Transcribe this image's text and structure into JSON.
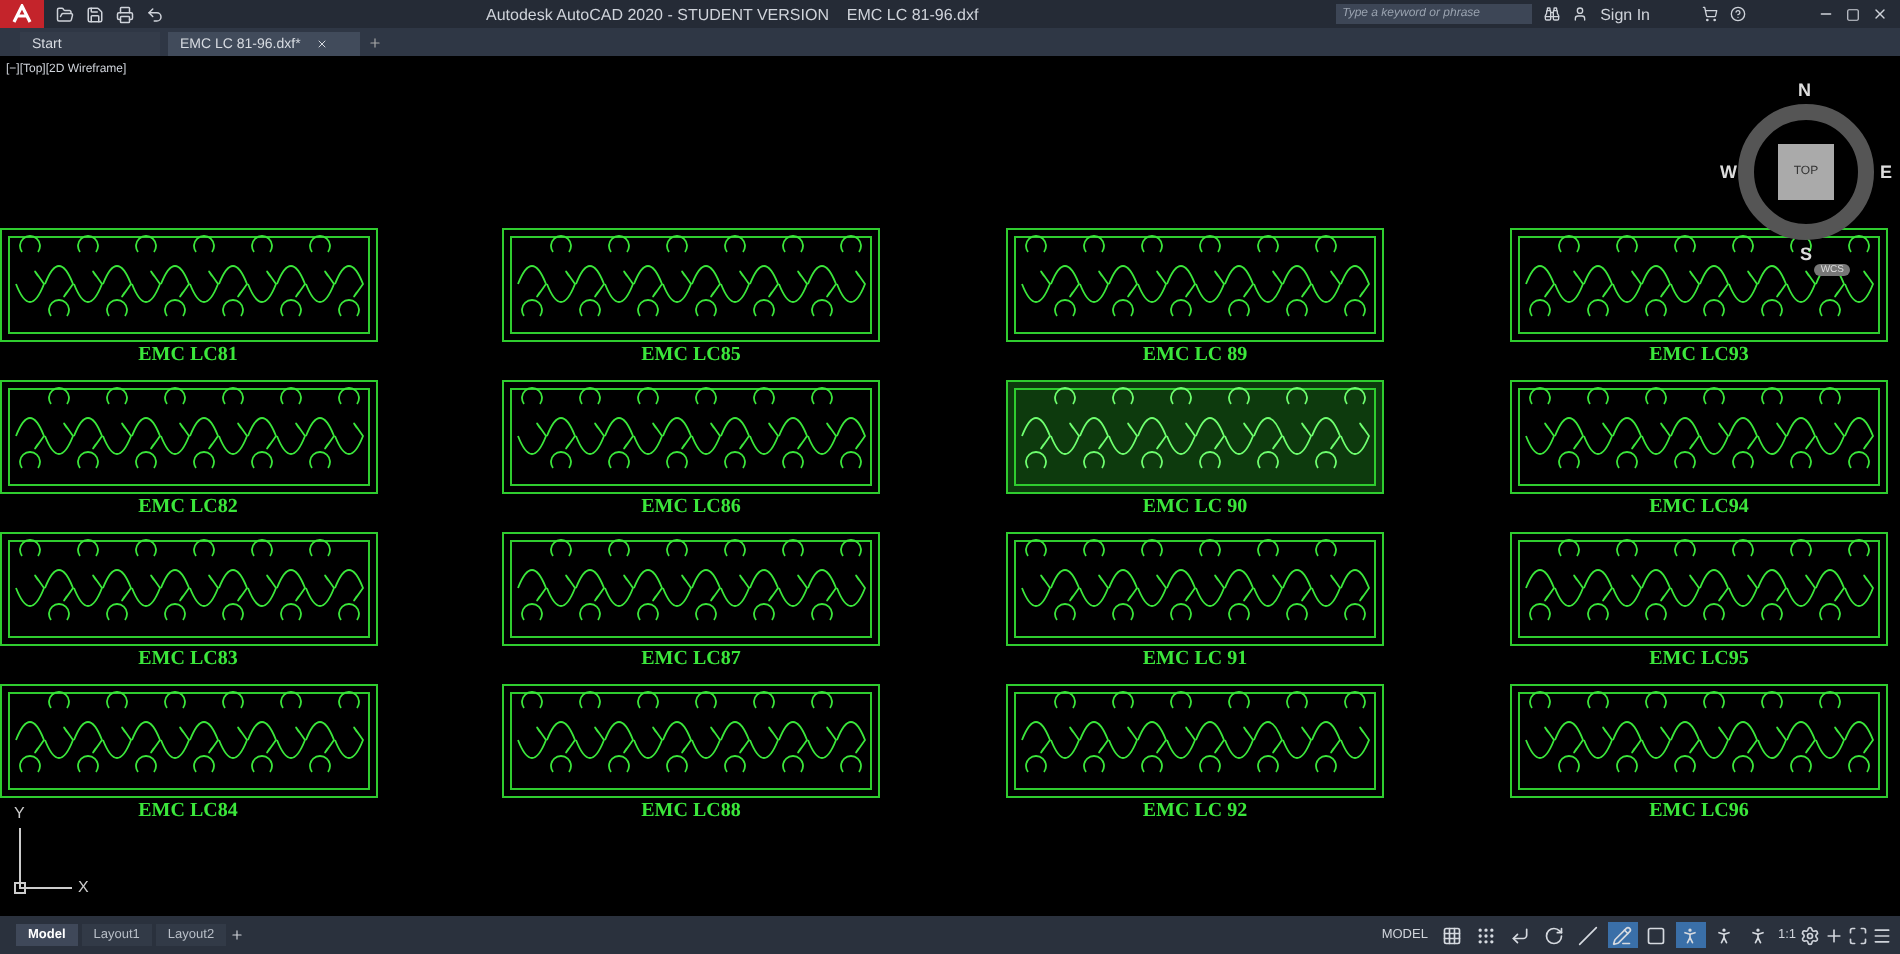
{
  "window": {
    "title": "Autodesk AutoCAD 2020 - STUDENT VERSION    EMC LC 81-96.dxf"
  },
  "search": {
    "placeholder": "Type a keyword or phrase"
  },
  "sign_in": "Sign In",
  "file_tabs": [
    {
      "label": "Start",
      "selected": false
    },
    {
      "label": "EMC LC 81-96.dxf*",
      "selected": true
    }
  ],
  "viewport_label": "[−][Top][2D Wireframe]",
  "viewcube": {
    "north": "N",
    "east": "E",
    "south": "S",
    "west": "W",
    "face": "TOP",
    "ucs": "WCS"
  },
  "panels": [
    [
      {
        "label": "EMC LC81"
      },
      {
        "label": "EMC LC82"
      },
      {
        "label": "EMC LC83"
      },
      {
        "label": "EMC LC84"
      }
    ],
    [
      {
        "label": "EMC LC85"
      },
      {
        "label": "EMC LC86"
      },
      {
        "label": "EMC LC87"
      },
      {
        "label": "EMC LC88"
      }
    ],
    [
      {
        "label": "EMC LC 89"
      },
      {
        "label": "EMC LC 90"
      },
      {
        "label": "EMC LC 91"
      },
      {
        "label": "EMC LC 92"
      }
    ],
    [
      {
        "label": "EMC LC93"
      },
      {
        "label": "EMC LC94"
      },
      {
        "label": "EMC LC95"
      },
      {
        "label": "EMC LC96"
      }
    ]
  ],
  "ucs_icon": {
    "x": "X",
    "y": "Y"
  },
  "layout_tabs": [
    {
      "label": "Model",
      "selected": true
    },
    {
      "label": "Layout1",
      "selected": false
    },
    {
      "label": "Layout2",
      "selected": false
    }
  ],
  "status_bar": {
    "space": "MODEL",
    "scale": "1:1",
    "tools": [
      {
        "kind": "grid",
        "on": false
      },
      {
        "kind": "snap",
        "on": false
      },
      {
        "kind": "ortho",
        "on": false
      },
      {
        "kind": "polar",
        "on": false
      },
      {
        "kind": "osnap",
        "on": false
      },
      {
        "kind": "angle",
        "on": true
      },
      {
        "kind": "frame",
        "on": false
      },
      {
        "kind": "annotate",
        "on": true
      },
      {
        "kind": "figure",
        "on": false
      },
      {
        "kind": "figure",
        "on": false
      }
    ]
  }
}
